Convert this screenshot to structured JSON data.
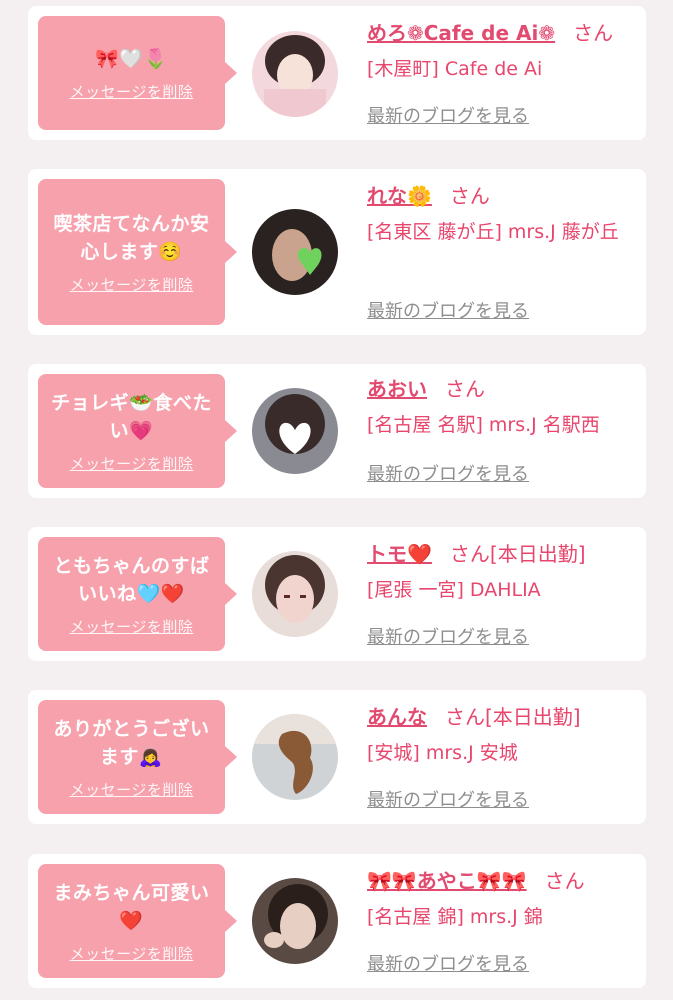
{
  "cards": [
    {
      "message": "🎀🤍🌷",
      "delete_label": "メッセージを削除",
      "name": "めろ❁Cafe de Ai❁",
      "honorific": "さん",
      "extra": "",
      "shop": "[木屋町] Cafe de Ai",
      "blog_label": "最新のブログを見る",
      "avatar_colors": [
        "#f3d9de",
        "#3b2a2a",
        "#f6e2d8"
      ]
    },
    {
      "message": "喫茶店てなんか安心します☺️",
      "delete_label": "メッセージを削除",
      "name": "れな🌼",
      "honorific": "さん",
      "extra": "",
      "shop": "[名東区 藤が丘] mrs.J 藤が丘",
      "blog_label": "最新のブログを見る",
      "avatar_colors": [
        "#2a2220",
        "#6fd25c",
        "#c9a38e"
      ]
    },
    {
      "message": "チョレギ🥗食べたい💗",
      "delete_label": "メッセージを削除",
      "name": "あおい",
      "honorific": "さん",
      "extra": "",
      "shop": "[名古屋 名駅] mrs.J 名駅西",
      "blog_label": "最新のブログを見る",
      "avatar_colors": [
        "#8a8a93",
        "#ffffff",
        "#3a2b2b"
      ]
    },
    {
      "message": "ともちゃんのすばいいね🩵❤️",
      "delete_label": "メッセージを削除",
      "name": "トモ❤️",
      "honorific": "さん",
      "extra": "[本日出勤]",
      "shop": "[尾張 一宮] DAHLIA",
      "blog_label": "最新のブログを見る",
      "avatar_colors": [
        "#e8ddd8",
        "#4a3530",
        "#f2d4cf"
      ]
    },
    {
      "message": "ありがとうございます🙇‍♀️",
      "delete_label": "メッセージを削除",
      "name": "あんな",
      "honorific": "さん",
      "extra": "[本日出勤]",
      "shop": "[安城] mrs.J 安城",
      "blog_label": "最新のブログを見る",
      "avatar_colors": [
        "#cfd3d6",
        "#8a5a36",
        "#e9e2dc"
      ]
    },
    {
      "message": "まみちゃん可愛い❤️",
      "delete_label": "メッセージを削除",
      "name": "🎀🎀あやこ🎀🎀",
      "honorific": "さん",
      "extra": "",
      "shop": "[名古屋 錦] mrs.J 錦",
      "blog_label": "最新のブログを見る",
      "avatar_colors": [
        "#5a4a44",
        "#2b1f1c",
        "#e8cfc4"
      ]
    }
  ]
}
